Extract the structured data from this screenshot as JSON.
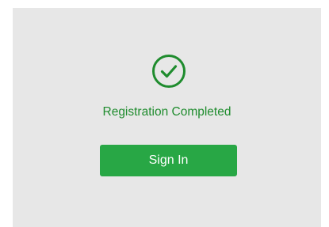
{
  "status": {
    "icon": "check-circle-icon",
    "message": "Registration Completed",
    "color": "#1f8c2e"
  },
  "actions": {
    "signin_label": "Sign In",
    "signin_color": "#28a745"
  },
  "panel": {
    "background": "#e7e7e7"
  }
}
